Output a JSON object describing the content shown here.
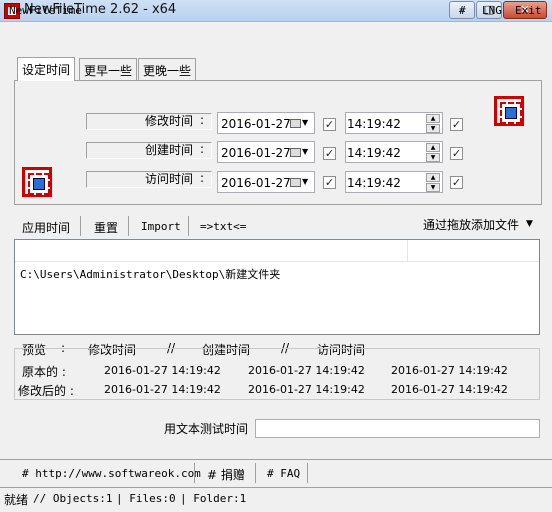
{
  "window": {
    "title": "NewFileTime 2.62 - x64"
  },
  "menu": {
    "app": "NewFileTime",
    "hash": "#",
    "lng": "LNG",
    "exit": "Exit"
  },
  "tabs": [
    {
      "label": "设定时间"
    },
    {
      "label": "更早一些"
    },
    {
      "label": "更晚一些"
    }
  ],
  "rows": [
    {
      "label": "修改时间",
      "colon": ":",
      "date": "2016-01-27",
      "time": "14:19:42"
    },
    {
      "label": "创建时间",
      "colon": ":",
      "date": "2016-01-27",
      "time": "14:19:42"
    },
    {
      "label": "访问时间",
      "colon": ":",
      "date": "2016-01-27",
      "time": "14:19:42"
    }
  ],
  "toolbar": {
    "apply": "应用时间",
    "reset": "重置",
    "import": "Import",
    "txt": "=>txt<=",
    "dragdrop": "通过拖放添加文件"
  },
  "list": {
    "items": [
      "C:\\Users\\Administrator\\Desktop\\新建文件夹"
    ]
  },
  "preview": {
    "header": {
      "label": "预览",
      "colon": ":",
      "modify": "修改时间",
      "sep1": "//",
      "create": "创建时间",
      "sep2": "//",
      "access": "访问时间"
    },
    "original": {
      "label": "原本的 :",
      "modify": "2016-01-27 14:19:42",
      "create": "2016-01-27 14:19:42",
      "access": "2016-01-27 14:19:42"
    },
    "modified": {
      "label": "修改后的 :",
      "modify": "2016-01-27 14:19:42",
      "create": "2016-01-27 14:19:42",
      "access": "2016-01-27 14:19:42"
    }
  },
  "test": {
    "label": "用文本测试时间",
    "value": ""
  },
  "footer": {
    "website": "# http://www.softwareok.com",
    "donate": "# 捐赠",
    "faq": "# FAQ"
  },
  "status": {
    "ready": "就绪",
    "objects": "// Objects:1",
    "files": "| Files:0",
    "folder": "| Folder:1"
  },
  "colors": {
    "accent": "#cc0000",
    "titlebar": "#b9d1ee"
  }
}
